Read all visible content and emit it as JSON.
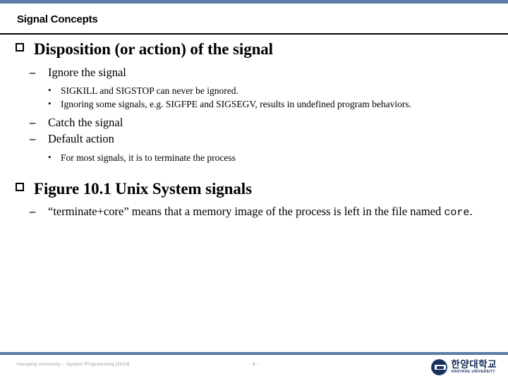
{
  "theme": {
    "accent_bar_color": "#5b7ba5",
    "rule_color": "#000000",
    "text_color": "#000000",
    "footer_text_color": "#8d9aa8",
    "logo_color": "#17305c"
  },
  "header": {
    "title": "Signal Concepts"
  },
  "content": {
    "section1": {
      "heading": "Disposition (or action) of the signal",
      "bullet_glyph": "❑",
      "items": [
        {
          "level": 2,
          "marker": "–",
          "text": "Ignore the signal"
        },
        {
          "level": 3,
          "marker": "•",
          "text": "SIGKILL and SIGSTOP can never be ignored."
        },
        {
          "level": 3,
          "marker": "•",
          "text": "Ignoring some signals, e.g. SIGFPE and SIGSEGV, results in undefined program behaviors."
        },
        {
          "level": 2,
          "marker": "–",
          "text": "Catch the signal"
        },
        {
          "level": 2,
          "marker": "–",
          "text": "Default action"
        },
        {
          "level": 3,
          "marker": "•",
          "text": "For most signals, it is to terminate the process"
        }
      ]
    },
    "section2": {
      "heading": "Figure 10.1 Unix System signals",
      "bullet_glyph": "❑",
      "item": {
        "level": 2,
        "marker": "–",
        "text_before": "“terminate+core” means that a memory image of the process is left in the file named ",
        "mono_text": "core",
        "text_after": "."
      }
    }
  },
  "footer": {
    "left_text": "Hanyang University – System Programming  [2013]",
    "page_label": "- 4 -",
    "logo": {
      "korean": "한양대학교",
      "english": "HANYANG UNIVERSITY"
    }
  }
}
